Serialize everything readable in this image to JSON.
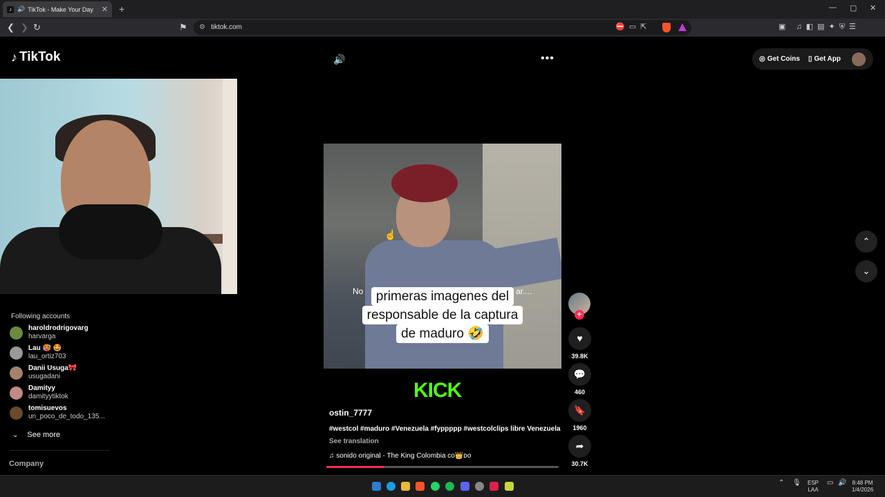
{
  "browser": {
    "tab_title": "TikTok - Make Your Day",
    "url": "tiktok.com",
    "new_tab": "+",
    "close": "✕"
  },
  "tiktok": {
    "logo_text": "TikTok",
    "top_right": {
      "get_coins": "Get Coins",
      "get_app": "Get App"
    },
    "sidebar": {
      "following_heading": "Following accounts",
      "accounts": [
        {
          "name": "haroldrodrigovarg",
          "handle": "harvarga",
          "color": "#6c8a3f"
        },
        {
          "name": "Lau 🥵 🤩",
          "handle": "lau_ortiz703",
          "color": "#9a9a9a"
        },
        {
          "name": "Danii Usuga🎀",
          "handle": "usugadani",
          "color": "#a5826b"
        },
        {
          "name": "Damityy",
          "handle": "damityytiktok",
          "color": "#c08a88"
        },
        {
          "name": "tomisuevos",
          "handle": "un_poco_de_todo_135...",
          "color": "#6b4a2c"
        }
      ],
      "see_more": "See more",
      "company": "Company"
    },
    "video": {
      "subtitle_left": "No",
      "subtitle_right": "ar....",
      "caption_lines": [
        "primeras imagenes del",
        "responsable de la captura",
        "de maduro 🤣"
      ],
      "watermark": "KICK",
      "creator": "ostin_7777",
      "description": "#westcol #maduro #Venezuela #fyppppp #westcolclips libre Venezuela",
      "see_translation": "See translation",
      "sound": "sonido original - The King Colombia co👑ᴅᴏ",
      "progress": 0.25
    },
    "actions": {
      "likes": "39.8K",
      "comments": "460",
      "saves": "1960",
      "shares": "30.7K"
    }
  },
  "taskbar": {
    "lang_top": "ESP",
    "lang_bottom": "LAA",
    "time": "8:48 PM",
    "date": "1/4/2026"
  }
}
